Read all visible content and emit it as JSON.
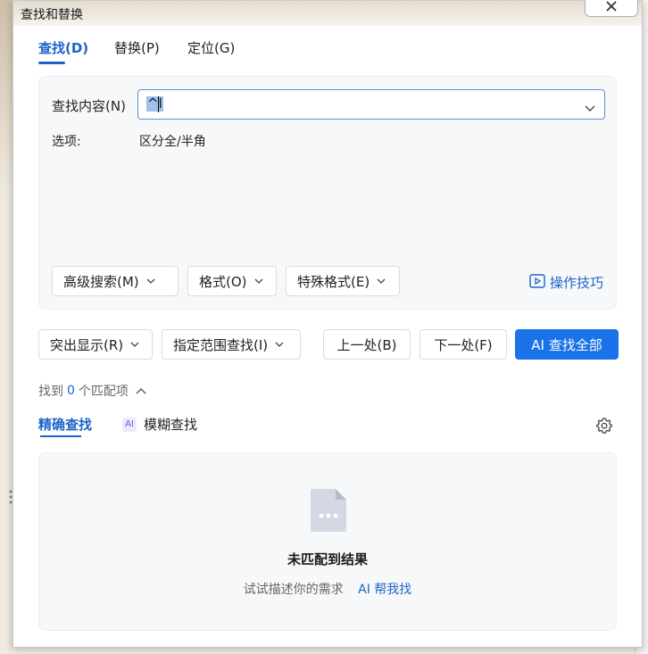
{
  "dialog": {
    "title": "查找和替换"
  },
  "tabs": [
    {
      "label": "查找(D)",
      "active": true
    },
    {
      "label": "替换(P)",
      "active": false
    },
    {
      "label": "定位(G)",
      "active": false
    }
  ],
  "find": {
    "label": "查找内容(N)",
    "value": "^l",
    "options_label": "选项:",
    "options_value": "区分全/半角"
  },
  "panel_buttons": {
    "advanced_search": "高级搜索(M)",
    "format": "格式(O)",
    "special_format": "特殊格式(E)",
    "tips": "操作技巧"
  },
  "actions": {
    "highlight": "突出显示(R)",
    "range_find": "指定范围查找(I)",
    "prev": "上一处(B)",
    "next": "下一处(F)",
    "ai_find_all": "AI 查找全部"
  },
  "results": {
    "found_prefix": "找到",
    "found_count": "0",
    "found_suffix": "个匹配项",
    "subtabs": [
      {
        "label": "精确查找",
        "active": true
      },
      {
        "label": "模糊查找",
        "active": false,
        "badge": "AI"
      }
    ],
    "empty_title": "未匹配到结果",
    "empty_hint": "试试描述你的需求",
    "ai_help": "AI 帮我找"
  },
  "colors": {
    "accent": "#1e64c8",
    "primary_button": "#1a73e8",
    "panel_bg": "#f7f8fa"
  }
}
